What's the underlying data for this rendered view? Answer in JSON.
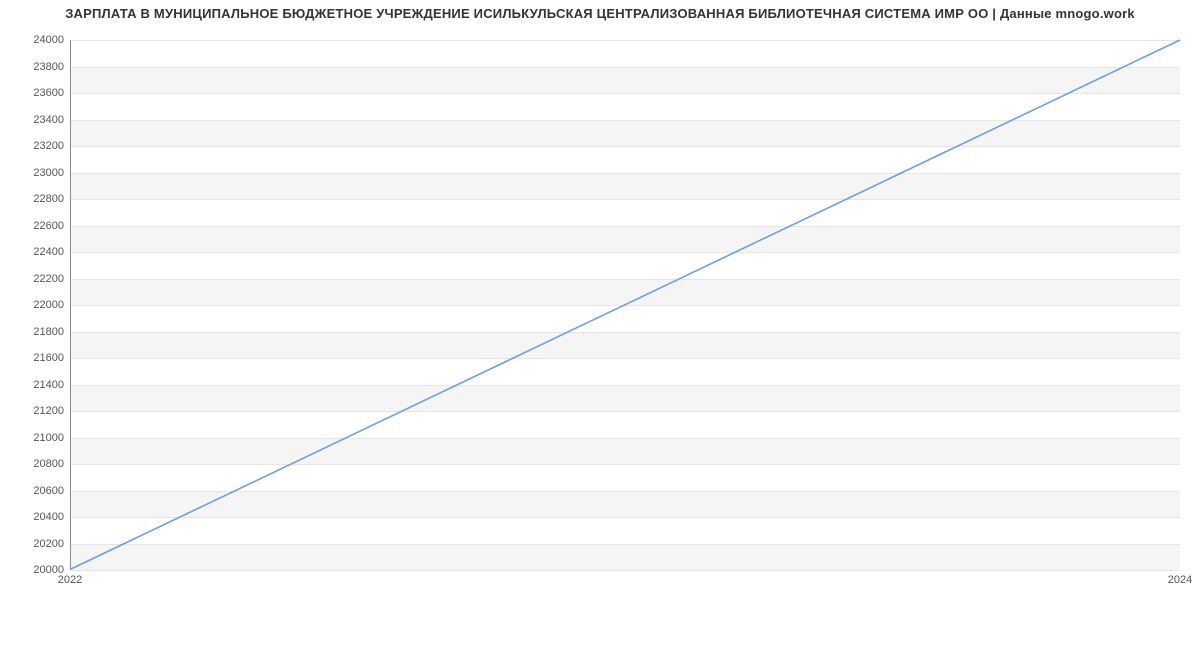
{
  "chart_data": {
    "type": "line",
    "title": "ЗАРПЛАТА В МУНИЦИПАЛЬНОЕ БЮДЖЕТНОЕ УЧРЕЖДЕНИЕ ИСИЛЬКУЛЬСКАЯ ЦЕНТРАЛИЗОВАННАЯ БИБЛИОТЕЧНАЯ СИСТЕМА ИМР ОО | Данные mnogo.work",
    "x": [
      2022,
      2024
    ],
    "values": [
      20000,
      24000
    ],
    "x_ticks": [
      2022,
      2024
    ],
    "y_ticks": [
      20000,
      20200,
      20400,
      20600,
      20800,
      21000,
      21200,
      21400,
      21600,
      21800,
      22000,
      22200,
      22400,
      22600,
      22800,
      23000,
      23200,
      23400,
      23600,
      23800,
      24000
    ],
    "xlabel": "",
    "ylabel": "",
    "xlim": [
      2022,
      2024
    ],
    "ylim": [
      20000,
      24000
    ],
    "line_color": "#6d9eeb",
    "grid": true
  }
}
